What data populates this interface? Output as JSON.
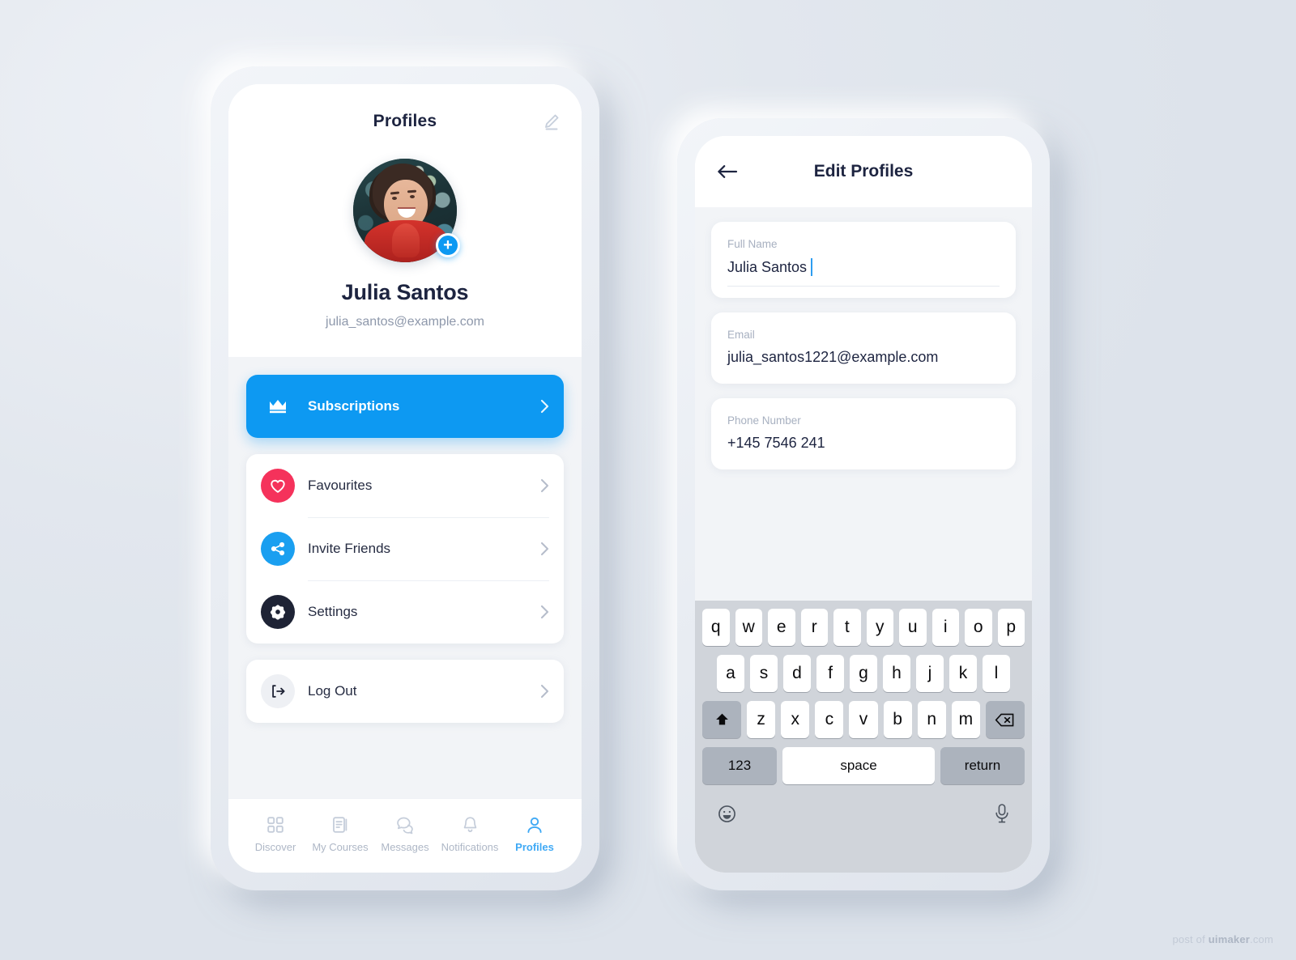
{
  "background_color": "#e2e7ee",
  "accent_color": "#0d99f2",
  "watermark": {
    "prefix": "post of ",
    "brand": "uimaker",
    "suffix": ".com"
  },
  "phone_left": {
    "header": {
      "title": "Profiles",
      "edit_icon": "pencil-edit-icon"
    },
    "profile": {
      "name": "Julia Santos",
      "email": "julia_santos@example.com",
      "avatar_alt": "avatar-photo",
      "add_badge": "+"
    },
    "menu_primary": {
      "label": "Subscriptions",
      "icon": "crown-icon",
      "chevron": "chevron-right-icon",
      "background": "#0d99f2"
    },
    "menu_items": [
      {
        "label": "Favourites",
        "icon": "heart-icon",
        "icon_color": "#f5325b",
        "chevron": "chevron-right-icon"
      },
      {
        "label": "Invite Friends",
        "icon": "share-icon",
        "icon_color": "#1a9ff0",
        "chevron": "chevron-right-icon"
      },
      {
        "label": "Settings",
        "icon": "gear-icon",
        "icon_color": "#1e2335",
        "chevron": "chevron-right-icon"
      }
    ],
    "logout": {
      "label": "Log Out",
      "icon": "logout-icon",
      "icon_color": "#eef0f4",
      "chevron": "chevron-right-icon"
    },
    "tabbar": [
      {
        "label": "Discover",
        "icon": "grid-icon",
        "active": false
      },
      {
        "label": "My Courses",
        "icon": "book-icon",
        "active": false
      },
      {
        "label": "Messages",
        "icon": "chat-bubbles-icon",
        "active": false
      },
      {
        "label": "Notifications",
        "icon": "bell-icon",
        "active": false
      },
      {
        "label": "Profiles",
        "icon": "person-icon",
        "active": true
      }
    ]
  },
  "phone_right": {
    "header": {
      "title": "Edit Profiles",
      "back_icon": "arrow-left-icon"
    },
    "fields": [
      {
        "label": "Full Name",
        "value": "Julia Santos",
        "focused": true
      },
      {
        "label": "Email",
        "value": "julia_santos1221@example.com",
        "focused": false
      },
      {
        "label": "Phone Number",
        "value": "+145 7546 241",
        "focused": false
      }
    ],
    "keyboard": {
      "row1": [
        "q",
        "w",
        "e",
        "r",
        "t",
        "y",
        "u",
        "i",
        "o",
        "p"
      ],
      "row2": [
        "a",
        "s",
        "d",
        "f",
        "g",
        "h",
        "j",
        "k",
        "l"
      ],
      "row3": [
        "z",
        "x",
        "c",
        "v",
        "b",
        "n",
        "m"
      ],
      "shift_key": "shift-icon",
      "backspace_key": "backspace-icon",
      "num_key": "123",
      "space_key": "space",
      "return_key": "return",
      "emoji_key": "emoji-smiley-icon",
      "mic_key": "microphone-icon"
    }
  }
}
